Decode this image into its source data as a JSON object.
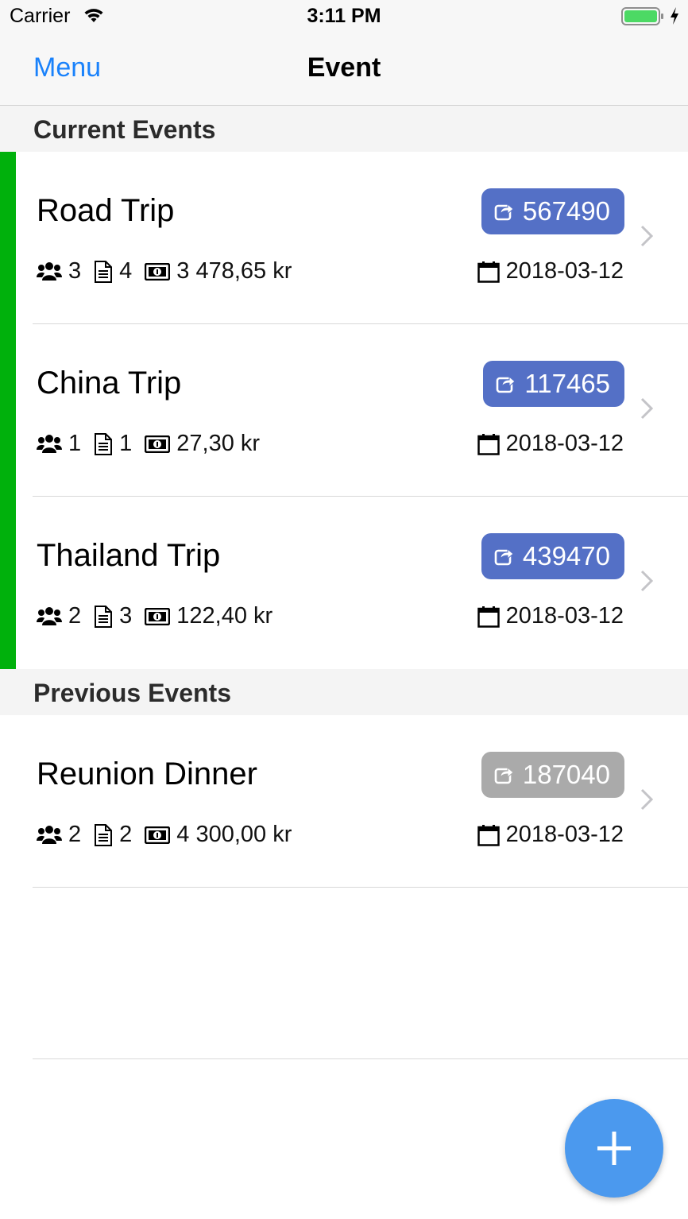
{
  "status_bar": {
    "carrier": "Carrier",
    "time": "3:11 PM",
    "battery_color": "#4cd964"
  },
  "nav": {
    "menu_label": "Menu",
    "title": "Event"
  },
  "sections": {
    "current": "Current Events",
    "previous": "Previous Events"
  },
  "colors": {
    "active": "#00b10c",
    "badge": "#5470c6",
    "badge_inactive": "#aaaaaa",
    "accent": "#1a82fb",
    "fab": "#4b99ee"
  },
  "icons": {
    "people": "users-icon",
    "receipts": "document-icon",
    "amount": "money-icon",
    "date": "calendar-icon",
    "share": "share-icon",
    "chevron": "chevron-right-icon",
    "add": "plus-icon"
  },
  "current_events": [
    {
      "name": "Road Trip",
      "code": "567490",
      "people": "3",
      "receipts": "4",
      "amount": "3 478,65 kr",
      "date": "2018-03-12"
    },
    {
      "name": "China Trip",
      "code": "117465",
      "people": "1",
      "receipts": "1",
      "amount": "27,30 kr",
      "date": "2018-03-12"
    },
    {
      "name": "Thailand Trip",
      "code": "439470",
      "people": "2",
      "receipts": "3",
      "amount": "122,40 kr",
      "date": "2018-03-12"
    }
  ],
  "previous_events": [
    {
      "name": "Reunion Dinner",
      "code": "187040",
      "people": "2",
      "receipts": "2",
      "amount": "4 300,00 kr",
      "date": "2018-03-12"
    }
  ]
}
